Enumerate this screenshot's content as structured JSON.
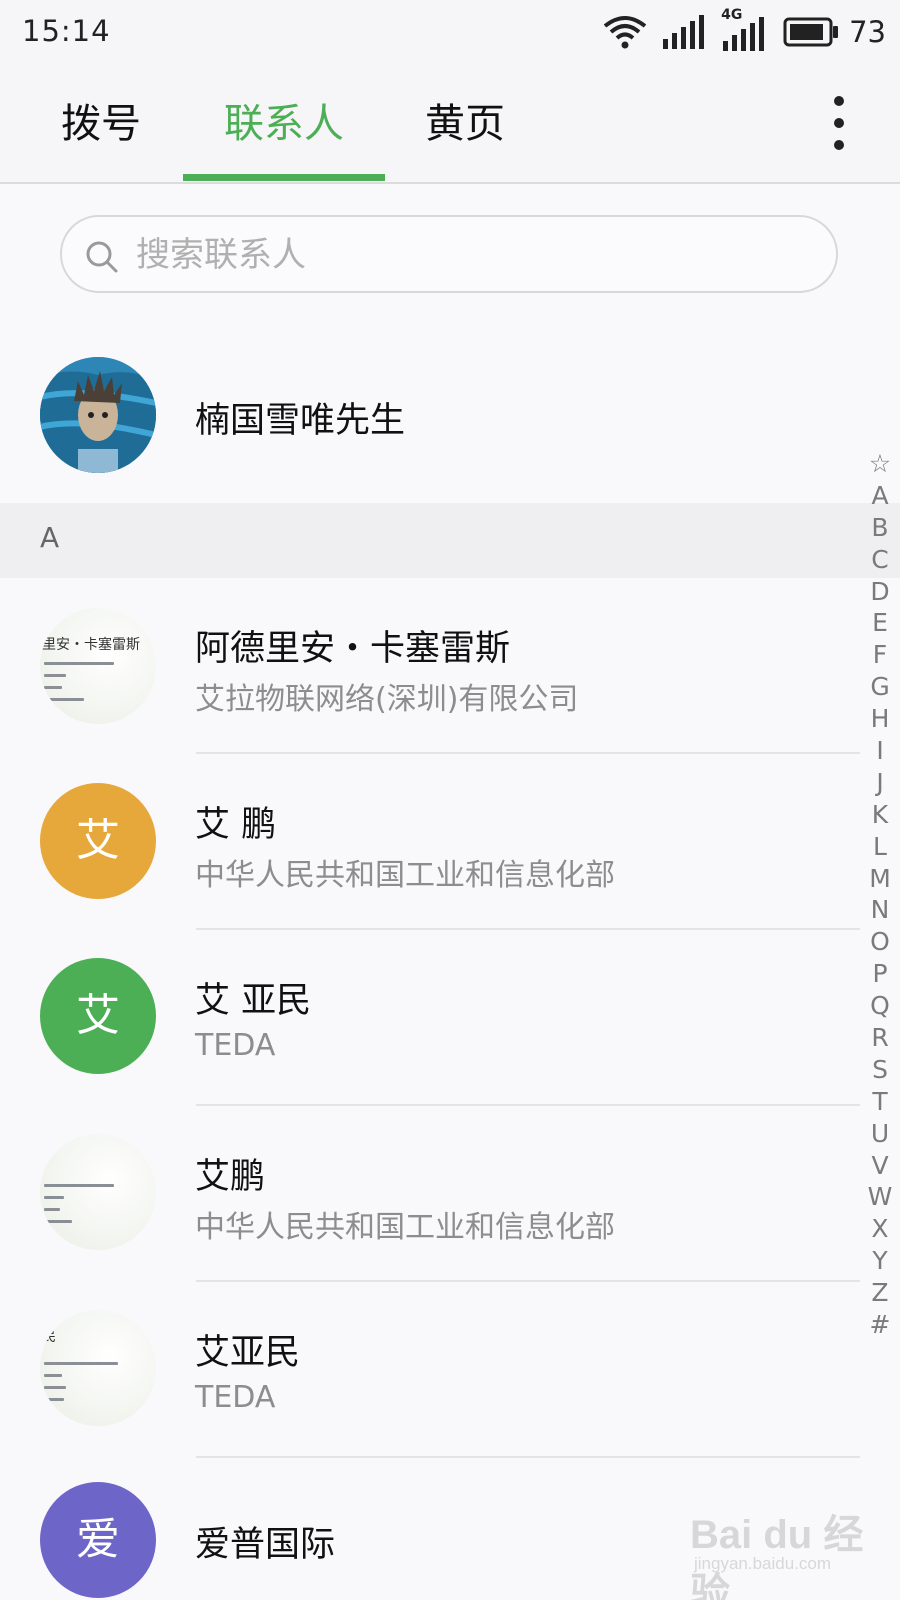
{
  "status_bar": {
    "time": "15:14",
    "network_label": "4G",
    "battery": "73"
  },
  "tabs": [
    {
      "label": "拨号",
      "active": false
    },
    {
      "label": "联系人",
      "active": true
    },
    {
      "label": "黄页",
      "active": false
    }
  ],
  "accent_color": "#4caf55",
  "search": {
    "placeholder": "搜索联系人"
  },
  "me": {
    "name": "楠国雪唯先生"
  },
  "section_letter": "A",
  "contacts": [
    {
      "name": "阿德里安・卡塞雷斯",
      "subtitle": "艾拉物联网络(深圳)有限公司",
      "avatar_type": "business-card",
      "card_text": "里安・卡塞雷斯"
    },
    {
      "name": "艾 鹏",
      "subtitle": "中华人民共和国工业和信息化部",
      "avatar_type": "letter",
      "avatar_letter": "艾",
      "avatar_color": "#e7a83b"
    },
    {
      "name": "艾 亚民",
      "subtitle": "TEDA",
      "avatar_type": "letter",
      "avatar_letter": "艾",
      "avatar_color": "#4caf55"
    },
    {
      "name": "艾鹏",
      "subtitle": "中华人民共和国工业和信息化部",
      "avatar_type": "business-card"
    },
    {
      "name": "艾亚民",
      "subtitle": "TEDA",
      "avatar_type": "business-card",
      "card_text": "民"
    },
    {
      "name": "爱普国际",
      "subtitle": "",
      "avatar_type": "letter",
      "avatar_letter": "爱",
      "avatar_color": "#6d66c8"
    }
  ],
  "index_letters": [
    "☆",
    "A",
    "B",
    "C",
    "D",
    "E",
    "F",
    "G",
    "H",
    "I",
    "J",
    "K",
    "L",
    "M",
    "N",
    "O",
    "P",
    "Q",
    "R",
    "S",
    "T",
    "U",
    "V",
    "W",
    "X",
    "Y",
    "Z",
    "#"
  ],
  "watermark": {
    "main": "Bai du 经验",
    "sub": "jingyan.baidu.com"
  }
}
